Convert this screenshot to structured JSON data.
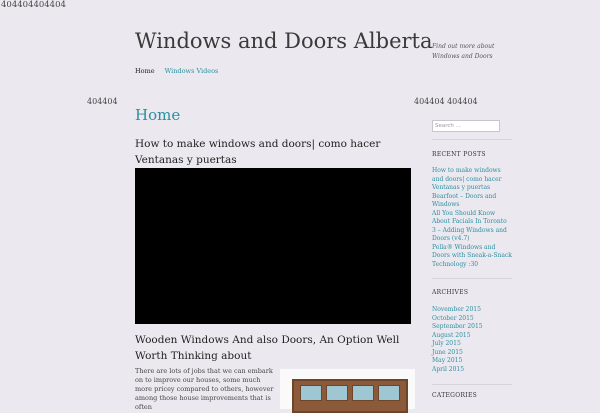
{
  "top_error": "404404404404",
  "site": {
    "title": "Windows and Doors Alberta",
    "tagline": "Find out more about Windows and Doors"
  },
  "nav": {
    "home": "Home",
    "videos": "Windows Videos"
  },
  "left_error": "404404",
  "right_error": "404404 404404",
  "page_heading": "Home",
  "posts": [
    {
      "title": "How to make windows and doors| como hacer Ventanas y puertas"
    },
    {
      "title": "Wooden Windows And also Doors, An Option Well Worth Thinking about",
      "excerpt": "There are lots of jobs that we can embark on to improve our houses, some much more pricey compared to others, however among those house improvements that is often"
    }
  ],
  "sidebar": {
    "search_placeholder": "Search ...",
    "recent_title": "RECENT POSTS",
    "recent": [
      "How to make windows and doors| como hacer Ventanas y puertas",
      "Bearfoot – Doors and Windows",
      "All You Should Know About Facials In Toronto",
      "3 – Adding Windows and Doors (v4.7)",
      "Pella® Windows and Doors with Sneak-a-Snack Technology :30"
    ],
    "archives_title": "ARCHIVES",
    "archives": [
      "November 2015",
      "October 2015",
      "September 2015",
      "August 2015",
      "July 2015",
      "June 2015",
      "May 2015",
      "April 2015"
    ],
    "categories_title": "CATEGORIES"
  },
  "colors": {
    "link": "#2a8fa0",
    "background": "#ebe9ef",
    "video": "#000000"
  }
}
